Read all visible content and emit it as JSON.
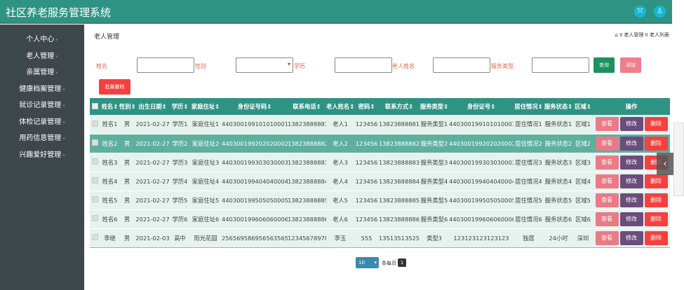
{
  "app": {
    "title": "社区养老服务管理系统",
    "icons": [
      "fullscreen-icon",
      "user-icon"
    ]
  },
  "sidebar": {
    "items": [
      {
        "label": "个人中心"
      },
      {
        "label": "老人管理"
      },
      {
        "label": "亲属管理"
      },
      {
        "label": "健康档案管理"
      },
      {
        "label": "就诊记录管理"
      },
      {
        "label": "体检记录管理"
      },
      {
        "label": "用药信息管理"
      },
      {
        "label": "兴趣爱好管理"
      }
    ],
    "caret": "▾"
  },
  "page": {
    "title": "老人管理",
    "breadcrumb": "II 老人管理 II 老人列表"
  },
  "search": {
    "labels": [
      "姓名",
      "性别",
      "学历",
      "老人姓名",
      "服务类型"
    ],
    "values": [
      "",
      "",
      "",
      "",
      ""
    ],
    "query": "查询",
    "add": "添加",
    "batch_delete": "批量删除"
  },
  "table": {
    "headers": [
      "姓名",
      "性别",
      "出生日期",
      "学历",
      "家庭住址",
      "身份证号码",
      "联系电话",
      "老人姓名",
      "密码",
      "联系方式",
      "服务类型",
      "身份证号",
      "居住情况",
      "服务状态",
      "区域",
      "操作"
    ],
    "sort_glyph": "⇕",
    "rows": [
      [
        "姓名1",
        "男",
        "2021-02-27",
        "学历1",
        "家庭住址1",
        "440300199101010001",
        "13823888881",
        "老人1",
        "123456",
        "13823888881",
        "服务类型1",
        "440300199101010001",
        "居住情况1",
        "服务状态1",
        "区域1"
      ],
      [
        "姓名2",
        "男",
        "2021-02-27",
        "学历2",
        "家庭住址2",
        "440300199202020002",
        "13823888882",
        "老人2",
        "123456",
        "13823888882",
        "服务类型2",
        "440300199202020002",
        "居住情况2",
        "服务状态2",
        "区域2"
      ],
      [
        "姓名3",
        "男",
        "2021-02-27",
        "学历3",
        "家庭住址3",
        "440300199303030003",
        "13823888883",
        "老人3",
        "123456",
        "13823888883",
        "服务类型3",
        "440300199303030003",
        "居住情况3",
        "服务状态3",
        "区域3"
      ],
      [
        "姓名4",
        "男",
        "2021-02-27",
        "学历4",
        "家庭住址4",
        "440300199404040004",
        "13823888884",
        "老人4",
        "123456",
        "13823888884",
        "服务类型4",
        "440300199404040004",
        "居住情况4",
        "服务状态4",
        "区域4"
      ],
      [
        "姓名5",
        "男",
        "2021-02-27",
        "学历5",
        "家庭住址5",
        "440300199505050005",
        "13823888885",
        "老人5",
        "123456",
        "13823888885",
        "服务类型5",
        "440300199505050005",
        "居住情况5",
        "服务状态5",
        "区域5"
      ],
      [
        "姓名6",
        "男",
        "2021-02-27",
        "学历6",
        "家庭住址6",
        "440300199606060006",
        "13823888886",
        "老人6",
        "123456",
        "13823888886",
        "服务类型6",
        "440300199606060006",
        "居住情况6",
        "服务状态6",
        "区域6"
      ],
      [
        "李继",
        "男",
        "2021-02-03",
        "高中",
        "阳光花园",
        "2565695869565635656",
        "12345678978",
        "李玉",
        "555",
        "13513513525",
        "类型3",
        "123123123123123",
        "独居",
        "24小时",
        "深圳"
      ]
    ],
    "actions": {
      "view": "查看",
      "edit": "修改",
      "delete": "删除"
    }
  },
  "pagination": {
    "page_size": "10",
    "per_page_label": "条每页",
    "current_page": "1"
  },
  "colors": {
    "header": "#2f9384",
    "sidebar": "#3e474c",
    "view": "#e87b86",
    "edit": "#6a4d7a",
    "delete": "#f5403f",
    "query": "#1e9161",
    "add": "#ee7f89"
  }
}
